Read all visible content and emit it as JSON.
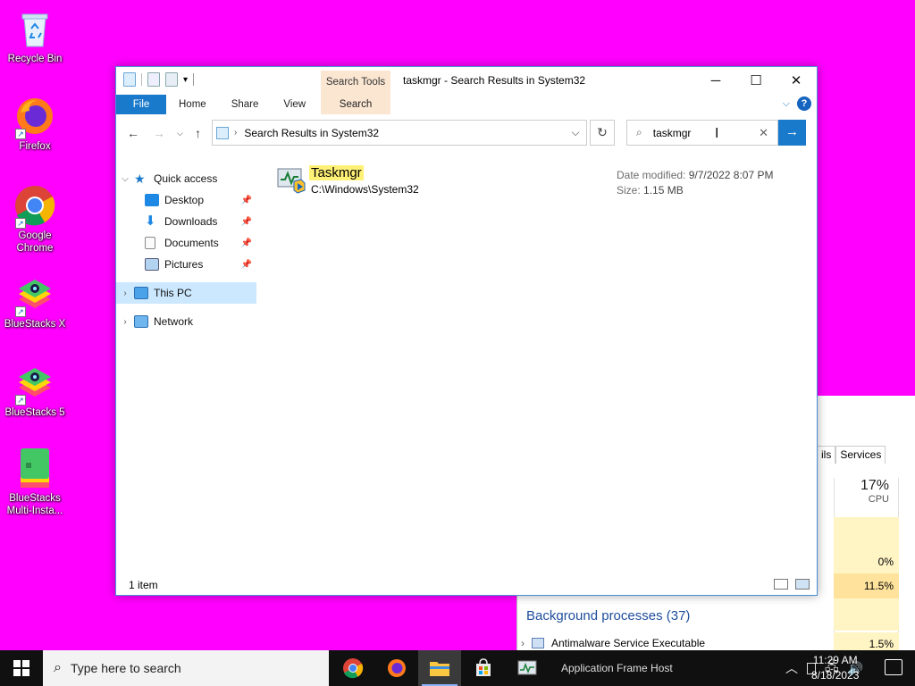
{
  "desktop": {
    "icons": [
      {
        "label": "Recycle Bin"
      },
      {
        "label": "Firefox"
      },
      {
        "label": "Google Chrome"
      },
      {
        "label": "BlueStacks X"
      },
      {
        "label": "BlueStacks 5"
      },
      {
        "label": "BlueStacks Multi-Insta..."
      }
    ]
  },
  "taskmgr": {
    "tab_partial": "ils",
    "tab_services": "Services",
    "cpu_percent": "17%",
    "cpu_label": "CPU",
    "cells": [
      "0%",
      "11.5%",
      "1.5%"
    ],
    "bg_processes": "Background processes (37)",
    "process_name": "Antimalware Service Executable"
  },
  "explorer": {
    "title": "taskmgr - Search Results in System32",
    "context_tab": "Search Tools",
    "ribbon": {
      "file": "File",
      "home": "Home",
      "share": "Share",
      "view": "View",
      "search": "Search"
    },
    "address": "Search Results in System32",
    "search_value": "taskmgr",
    "nav": {
      "quick_access": "Quick access",
      "desktop": "Desktop",
      "downloads": "Downloads",
      "documents": "Documents",
      "pictures": "Pictures",
      "this_pc": "This PC",
      "network": "Network"
    },
    "result": {
      "name": "Taskmgr",
      "path": "C:\\Windows\\System32",
      "date_label": "Date modified:",
      "date_value": "9/7/2022 8:07 PM",
      "size_label": "Size:",
      "size_value": "1.15 MB"
    },
    "status": "1 item"
  },
  "taskbar": {
    "search_placeholder": "Type here to search",
    "app_frame_host": "Application Frame Host",
    "time": "11:29 AM",
    "date": "8/18/2023"
  },
  "colors": {
    "accent": "#1979ca",
    "desktop": "#ff00ff",
    "selection": "#cce8ff",
    "highlight": "#fff176"
  }
}
